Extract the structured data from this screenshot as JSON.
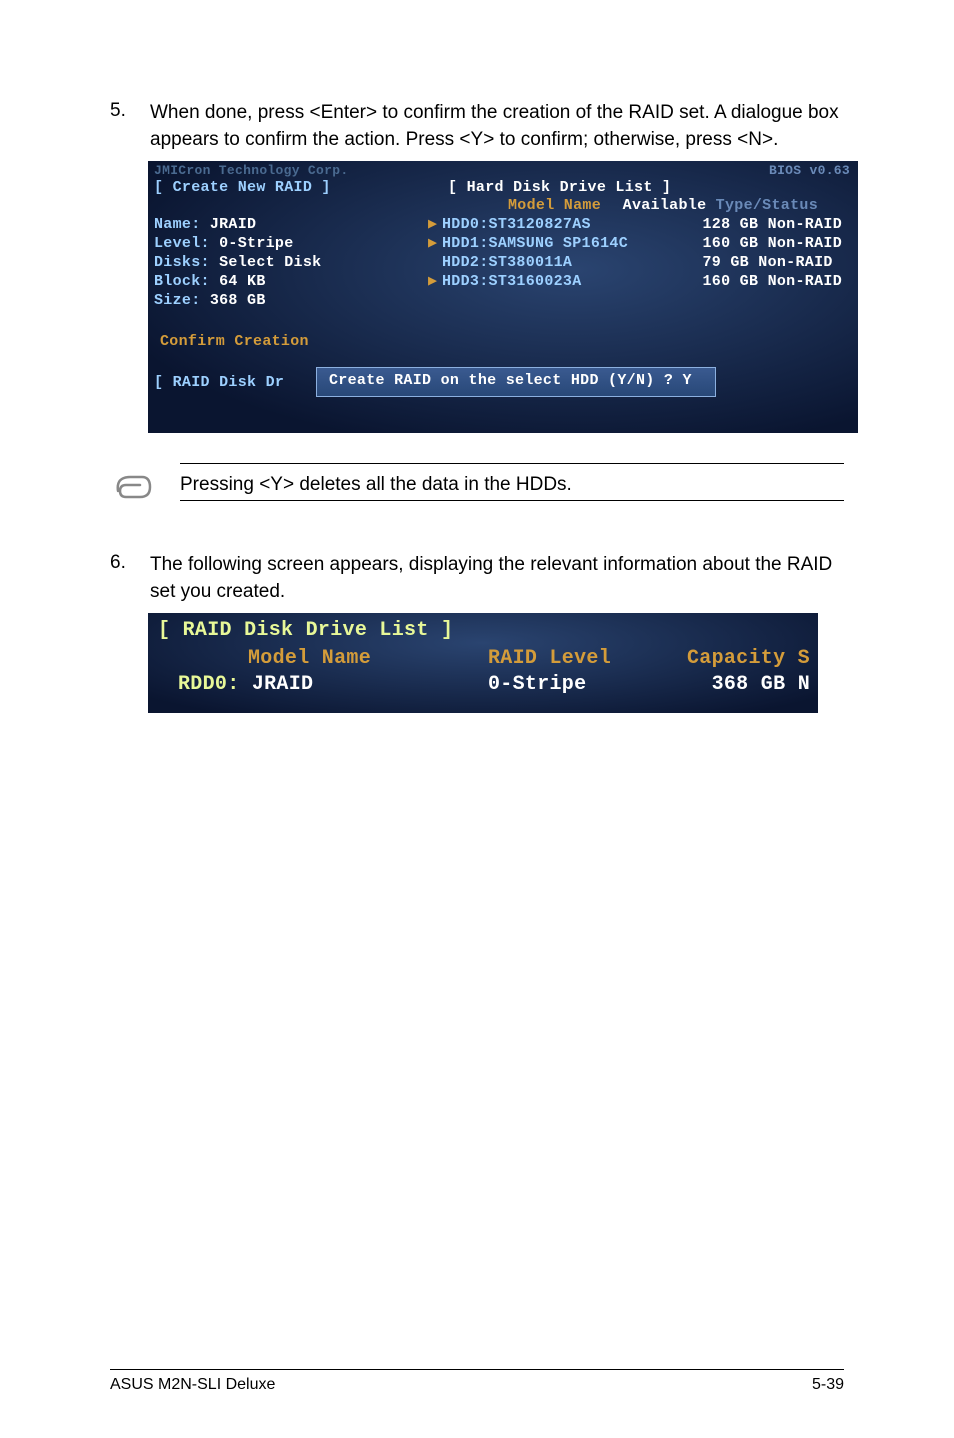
{
  "step5": {
    "number": "5.",
    "text": "When done, press <Enter> to confirm the creation of the RAID set. A dialogue box appears to confirm the action. Press <Y> to confirm; otherwise, press <N>."
  },
  "bios1": {
    "topfade": "JMICron Technology Corp.",
    "biosver": "BIOS v0.63",
    "create_head": "[ Create New RAID ]",
    "hdd_head": "[ Hard Disk Drive List ]",
    "model_name": "Model Name",
    "available_white": "Available",
    "available_faded": " Type/Status",
    "left": {
      "name_lbl": "Name:",
      "name_val": " JRAID",
      "level_lbl": "Level:",
      "level_val": " 0-Stripe",
      "disks_lbl": "Disks:",
      "disks_val": " Select Disk",
      "block_lbl": "Block:",
      "block_val": "  64 KB",
      "size_lbl": "Size:",
      "size_val": "  368 GB"
    },
    "drives": [
      {
        "mark": "▶",
        "lbl": "HDD0:",
        "val": " ST3120827AS"
      },
      {
        "mark": "▶",
        "lbl": "HDD1:",
        "val": " SAMSUNG SP1614C"
      },
      {
        "mark": "",
        "lbl": "HDD2:",
        "val": " ST380011A"
      },
      {
        "mark": "▶",
        "lbl": "HDD3:",
        "val": " ST3160023A"
      }
    ],
    "caps": [
      "128 GB Non-RAID",
      "160 GB Non-RAID",
      " 79 GB Non-RAID",
      "160 GB Non-RAID"
    ],
    "confirm": "Confirm Creation",
    "raid_disk": "[ RAID Disk Dr",
    "dialog": "Create RAID on the select HDD (Y/N) ? Y"
  },
  "note": {
    "text": "Pressing <Y> deletes all the data in the HDDs."
  },
  "step6": {
    "number": "6.",
    "text": "The following screen appears, displaying the relevant information about the RAID set you created."
  },
  "bios2": {
    "head": "[ RAID Disk Drive List ]",
    "model_name": "Model Name",
    "raid_level": "RAID Level",
    "capacity": "Capacity S",
    "rdd_lbl": "RDD0:",
    "rdd_val": " JRAID",
    "stripe": "0-Stripe",
    "size": "368 GB N"
  },
  "footer": {
    "left": "ASUS M2N-SLI Deluxe",
    "right": "5-39"
  }
}
